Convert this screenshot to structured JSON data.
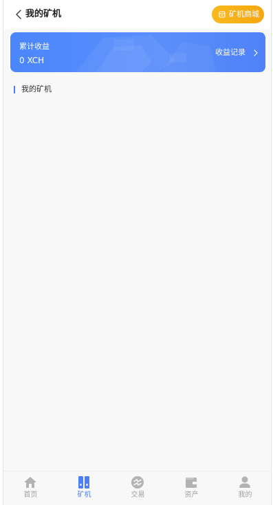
{
  "header": {
    "title": "我的矿机",
    "back_icon": "chevron-left-icon",
    "shop_button_label": "矿机商城",
    "shop_icon": "store-icon"
  },
  "banner": {
    "label": "累计收益",
    "value": "0 XCH",
    "records_label": "收益记录",
    "records_icon": "chevron-right-icon"
  },
  "section": {
    "title": "我的矿机"
  },
  "tabbar": {
    "items": [
      {
        "label": "首页",
        "icon": "home-icon",
        "active": false
      },
      {
        "label": "矿机",
        "icon": "miner-icon",
        "active": true
      },
      {
        "label": "交易",
        "icon": "exchange-icon",
        "active": false
      },
      {
        "label": "资产",
        "icon": "wallet-icon",
        "active": false
      },
      {
        "label": "我的",
        "icon": "user-icon",
        "active": false
      }
    ]
  },
  "colors": {
    "accent": "#4b7ff5",
    "banner_start": "#4b86fb",
    "shop_button": "#f8b91e",
    "inactive_tab": "#a0a0a0",
    "background": "#f9f9f9"
  }
}
